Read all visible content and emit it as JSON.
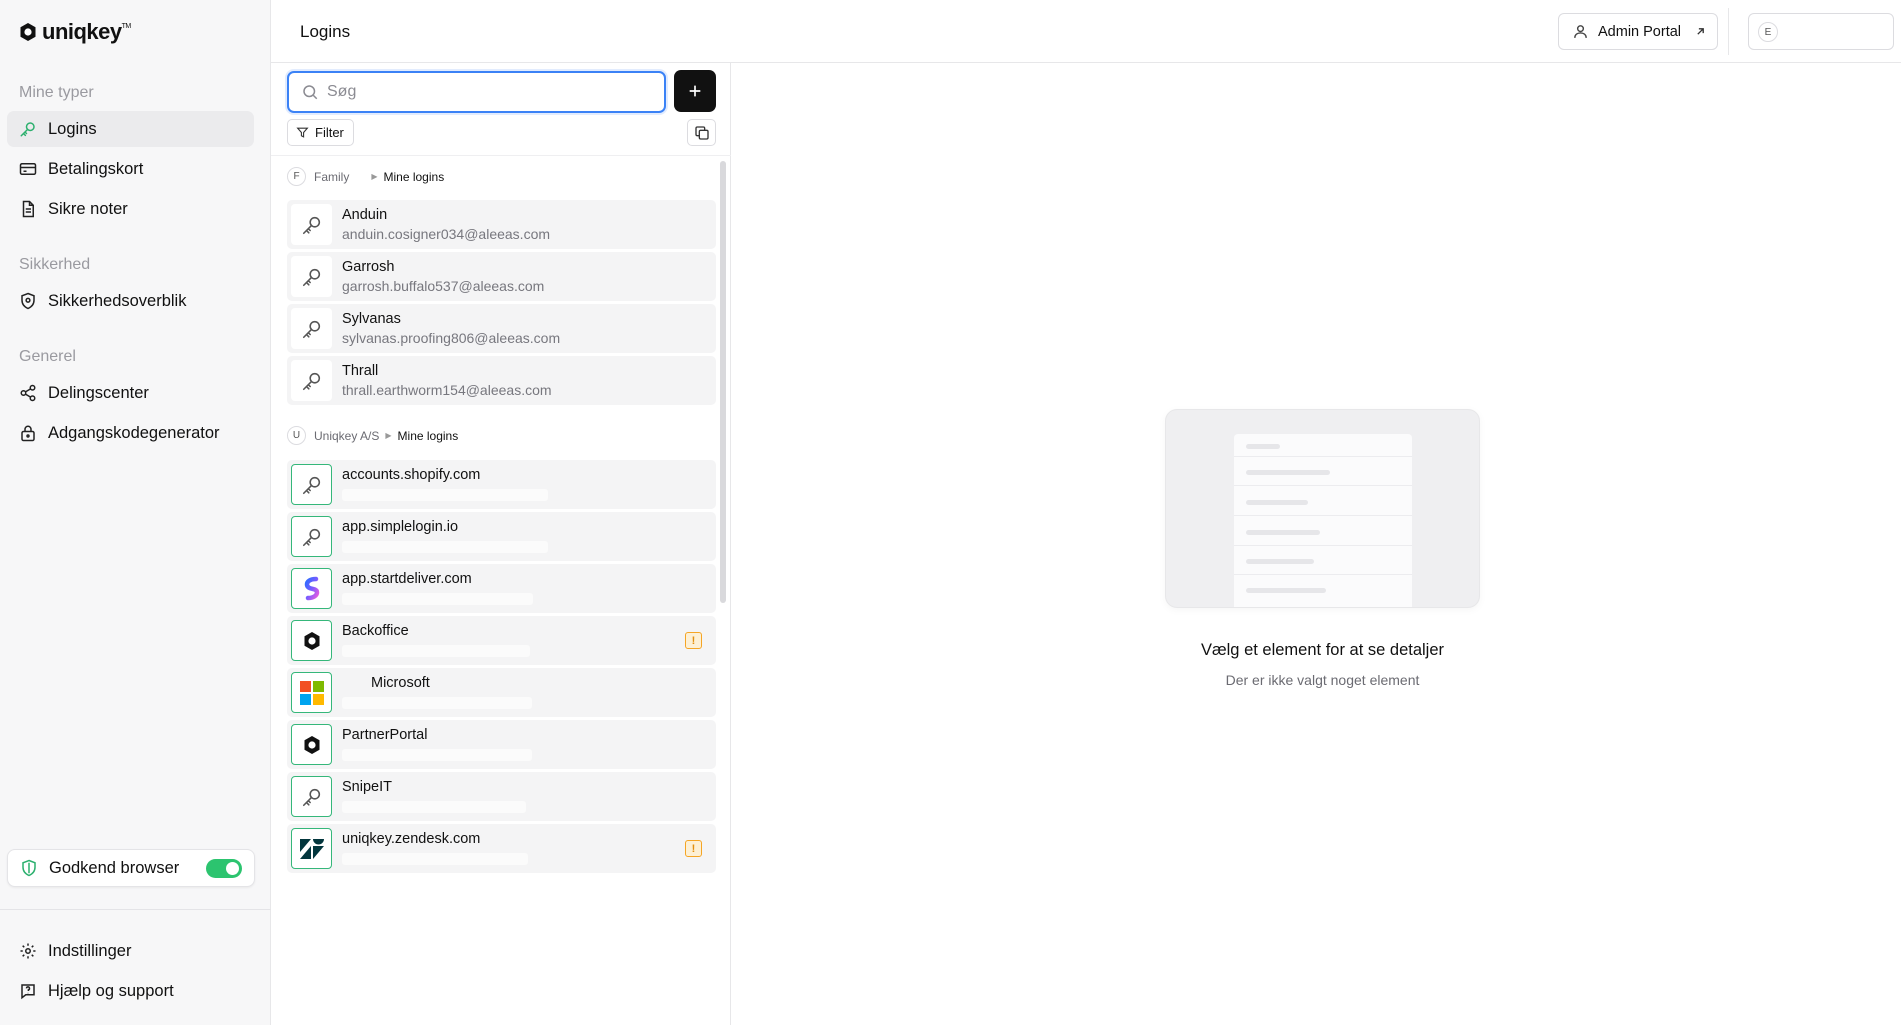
{
  "brand": {
    "name": "uniqkey",
    "tm": "TM"
  },
  "sidebar": {
    "sections": [
      {
        "title": "Mine typer",
        "items": [
          {
            "label": "Logins",
            "icon": "key-icon",
            "active": true
          },
          {
            "label": "Betalingskort",
            "icon": "credit-card-icon"
          },
          {
            "label": "Sikre noter",
            "icon": "note-icon"
          }
        ]
      },
      {
        "title": "Sikkerhed",
        "items": [
          {
            "label": "Sikkerhedsoverblik",
            "icon": "shield-icon"
          }
        ]
      },
      {
        "title": "Generel",
        "items": [
          {
            "label": "Delingscenter",
            "icon": "share-icon"
          },
          {
            "label": "Adgangskodegenerator",
            "icon": "lock-icon"
          }
        ]
      }
    ],
    "approve_browser": {
      "label": "Godkend browser",
      "enabled": true
    },
    "footer": [
      {
        "label": "Indstillinger",
        "icon": "gear-icon"
      },
      {
        "label": "Hjælp og support",
        "icon": "help-icon"
      }
    ]
  },
  "header": {
    "title": "Logins",
    "admin_portal": "Admin Portal",
    "user_initial": "E"
  },
  "list": {
    "search_placeholder": "Søg",
    "filter_label": "Filter",
    "groups": [
      {
        "badge": "F",
        "name": "Family",
        "sub": "Mine logins",
        "items": [
          {
            "title": "Anduin",
            "subtitle": "anduin.cosigner034@aleeas.com",
            "icon": "key-icon"
          },
          {
            "title": "Garrosh",
            "subtitle": "garrosh.buffalo537@aleeas.com",
            "icon": "key-icon"
          },
          {
            "title": "Sylvanas",
            "subtitle": "sylvanas.proofing806@aleeas.com",
            "icon": "key-icon"
          },
          {
            "title": "Thrall",
            "subtitle": "thrall.earthworm154@aleeas.com",
            "icon": "key-icon"
          }
        ]
      },
      {
        "badge": "U",
        "name": "Uniqkey A/S",
        "sub": "Mine logins",
        "items": [
          {
            "title": "accounts.shopify.com",
            "icon": "key-icon",
            "warning": false
          },
          {
            "title": "app.simplelogin.io",
            "icon": "key-icon",
            "warning": false
          },
          {
            "title": "app.startdeliver.com",
            "icon": "startdeliver-logo-icon",
            "warning": false
          },
          {
            "title": "Backoffice",
            "icon": "uniqkey-logo-icon",
            "warning": true
          },
          {
            "title": "Microsoft",
            "icon": "microsoft-logo-icon",
            "warning": false
          },
          {
            "title": "PartnerPortal",
            "icon": "uniqkey-logo-icon",
            "warning": false
          },
          {
            "title": "SnipeIT",
            "icon": "key-icon",
            "warning": false
          },
          {
            "title": "uniqkey.zendesk.com",
            "icon": "zendesk-logo-icon",
            "warning": true
          }
        ]
      }
    ]
  },
  "detail": {
    "empty_title": "Vælg et element for at se detaljer",
    "empty_subtitle": "Der er ikke valgt noget element"
  },
  "colors": {
    "accent_green": "#35b77a",
    "toggle_on": "#2cc46f",
    "focus_blue": "#3b82f6",
    "warning": "#f5a524"
  }
}
